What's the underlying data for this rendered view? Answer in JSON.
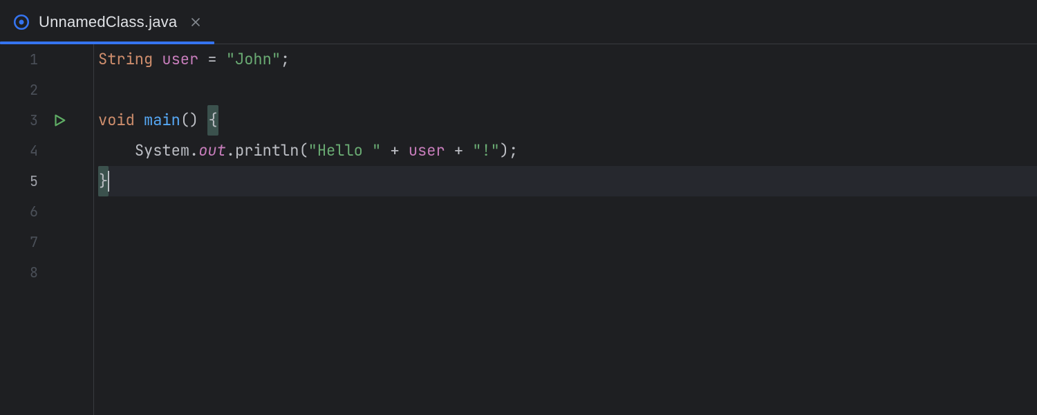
{
  "tab": {
    "filename": "UnnamedClass.java",
    "file_icon": "class-ring-icon",
    "close_icon": "close-icon",
    "active": true
  },
  "editor": {
    "current_line": 5,
    "run_gutter_line": 3,
    "run_icon": "run-triangle-icon",
    "line_numbers": [
      "1",
      "2",
      "3",
      "4",
      "5",
      "6",
      "7",
      "8"
    ],
    "code": {
      "l1": {
        "type_kw": "String",
        "var": "user",
        "assign": " = ",
        "string": "\"John\"",
        "semi": ";"
      },
      "l3": {
        "void_kw": "void",
        "method": "main",
        "parens": "()",
        "space": " ",
        "brace_open": "{"
      },
      "l4": {
        "indent": "    ",
        "obj": "System",
        "dot1": ".",
        "field": "out",
        "dot2": ".",
        "call": "println",
        "open": "(",
        "str1": "\"Hello \"",
        "plus1": " + ",
        "var": "user",
        "plus2": " + ",
        "str2": "\"!\"",
        "close": ")",
        "semi": ";"
      },
      "l5": {
        "brace_close": "}"
      }
    }
  }
}
